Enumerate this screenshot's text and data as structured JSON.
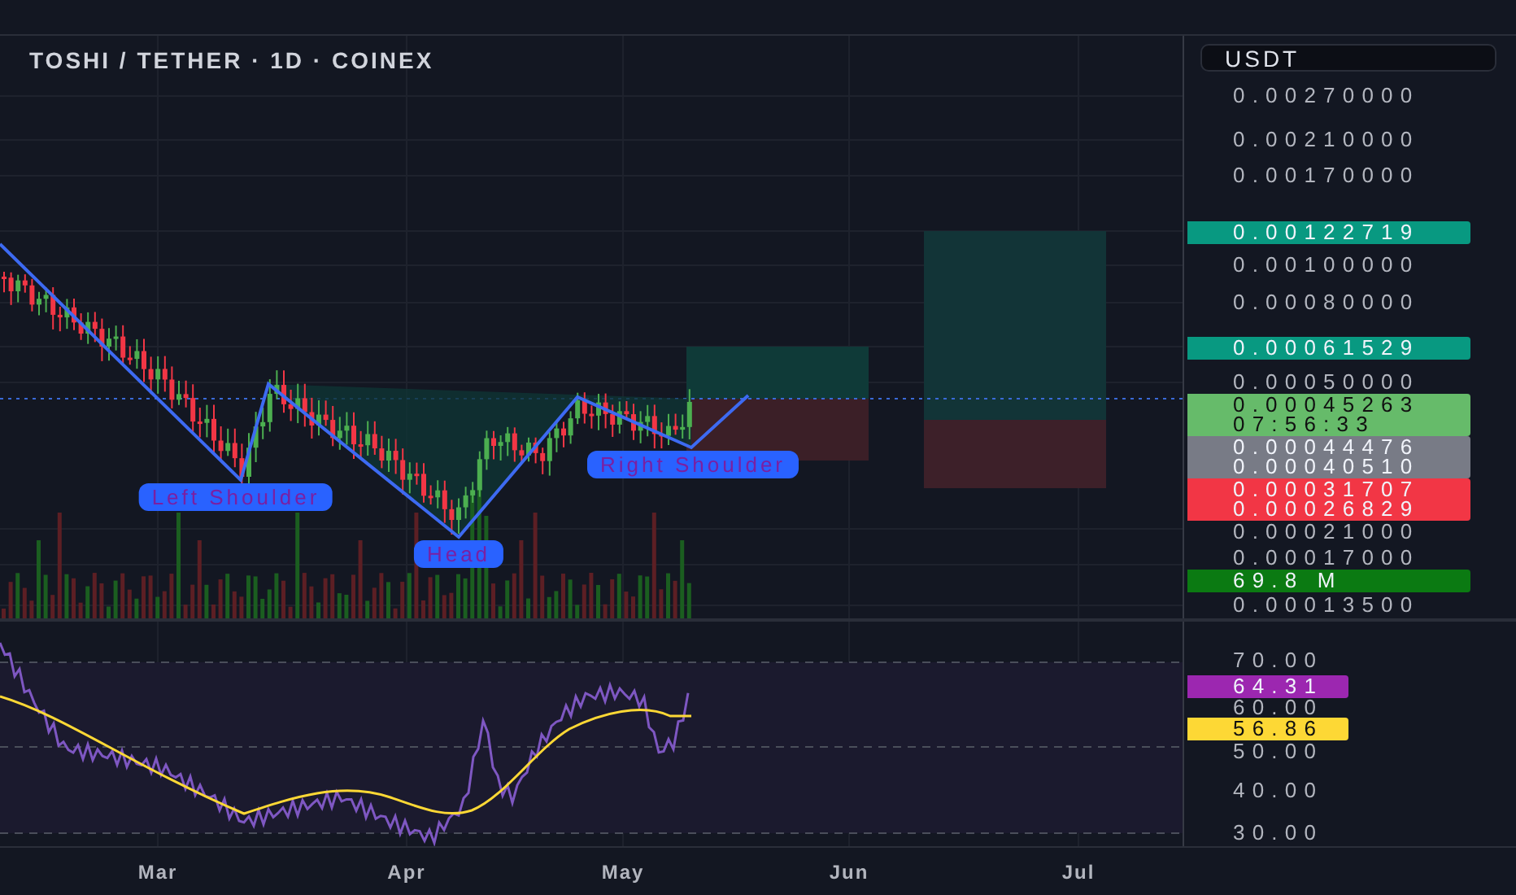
{
  "chart": {
    "title": "TOSHI / TETHER · 1D · COINEX",
    "pattern_labels": [
      "Left Shoulder",
      "Head",
      "Right Shoulder"
    ]
  },
  "price_axis": {
    "currency": "USDT",
    "labels": [
      {
        "kind": "tick",
        "text": "0.00270000"
      },
      {
        "kind": "tick",
        "text": "0.00210000"
      },
      {
        "kind": "tick",
        "text": "0.00170000"
      },
      {
        "kind": "badge",
        "color": "#089981",
        "lines": [
          "0.00122719"
        ]
      },
      {
        "kind": "tick",
        "text": "0.00100000"
      },
      {
        "kind": "tick",
        "text": "0.00080000"
      },
      {
        "kind": "badge",
        "color": "#089981",
        "lines": [
          "0.00061529"
        ]
      },
      {
        "kind": "tick",
        "text": "0.00050000"
      },
      {
        "kind": "badge",
        "color": "#66bb6a",
        "lines": [
          "0.00045263",
          "07:56:33"
        ]
      },
      {
        "kind": "badge",
        "color": "#787b86",
        "lines": [
          "0.00044476",
          "0.00040510"
        ]
      },
      {
        "kind": "badge",
        "color": "#f23645",
        "lines": [
          "0.00031707",
          "0.00026829"
        ]
      },
      {
        "kind": "tick",
        "text": "0.00021000"
      },
      {
        "kind": "tick",
        "text": "0.00017000"
      },
      {
        "kind": "badge",
        "color": "#0b7a12",
        "lines": [
          "69.8 M"
        ]
      },
      {
        "kind": "tick",
        "text": "0.00013500"
      }
    ]
  },
  "rsi_axis": {
    "labels": [
      {
        "kind": "tick",
        "text": "70.00"
      },
      {
        "kind": "badge",
        "color": "#9c27b0",
        "lines": [
          "64.31"
        ]
      },
      {
        "kind": "tick",
        "text": "60.00"
      },
      {
        "kind": "badge",
        "color": "#fdd835",
        "lines": [
          "56.86"
        ]
      },
      {
        "kind": "tick",
        "text": "50.00"
      },
      {
        "kind": "tick",
        "text": "40.00"
      },
      {
        "kind": "tick",
        "text": "30.00"
      }
    ]
  },
  "time_axis": {
    "labels": [
      "Mar",
      "Apr",
      "May",
      "Jun",
      "Jul"
    ]
  }
}
